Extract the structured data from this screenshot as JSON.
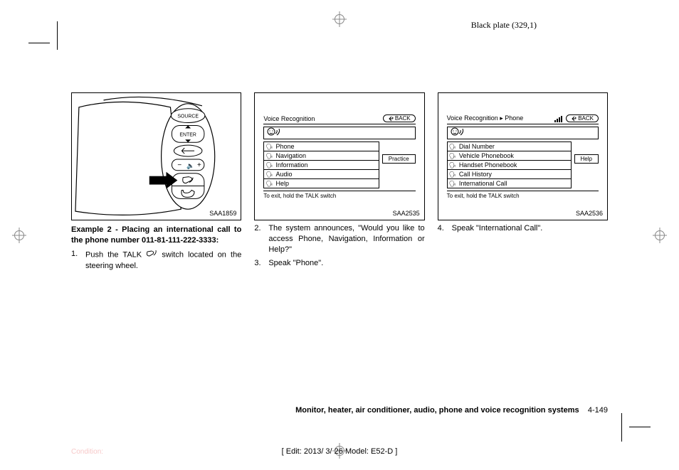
{
  "header": {
    "plate": "Black plate (329,1)"
  },
  "col1": {
    "fig_id": "SAA1859",
    "heading": "Example 2 - Placing an international call to the phone number 011-81-111-222-3333:",
    "step1_num": "1.",
    "step1a": "Push the TALK",
    "step1b": "switch located on the steering wheel."
  },
  "col2": {
    "fig_id": "SAA2535",
    "screen": {
      "title": "Voice Recognition",
      "back": "BACK",
      "items": [
        "Phone",
        "Navigation",
        "Information",
        "Audio",
        "Help"
      ],
      "side_btn": "Practice",
      "exit_hint": "To exit, hold the TALK switch"
    },
    "step2_num": "2.",
    "step2": "The system announces, \"Would you like to access Phone, Navigation, Information or Help?\"",
    "step3_num": "3.",
    "step3": "Speak \"Phone\"."
  },
  "col3": {
    "fig_id": "SAA2536",
    "screen": {
      "title": "Voice Recognition ▸ Phone",
      "back": "BACK",
      "items": [
        "Dial Number",
        "Vehicle Phonebook",
        "Handset Phonebook",
        "Call History",
        "International Call"
      ],
      "side_btn": "Help",
      "exit_hint": "To exit, hold the TALK switch"
    },
    "step4_num": "4.",
    "step4": "Speak \"International Call\"."
  },
  "footer": {
    "chapter": "Monitor, heater, air conditioner, audio, phone and voice recognition systems",
    "page": "4-149",
    "edit": "[ Edit: 2013/ 3/ 26  Model: E52-D ]",
    "condition": "Condition:"
  }
}
